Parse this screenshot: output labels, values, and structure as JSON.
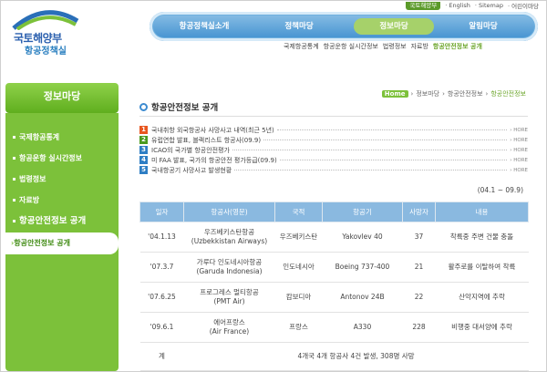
{
  "header": {
    "logo_main": "국토해양부",
    "logo_sub": "항공정책실",
    "util": [
      "국토해양부",
      "English",
      "Sitemap",
      "어린이마당"
    ]
  },
  "gnb": [
    "항공정책실소개",
    "정책마당",
    "정보마당",
    "알림마당"
  ],
  "lnb": [
    "국제항공통계",
    "항공운항 실시간정보",
    "법령정보",
    "자료방",
    "항공안전정보 공개"
  ],
  "sidebar": {
    "title": "정보마당",
    "items": [
      "국제항공통계",
      "항공운항 실시간정보",
      "법령정보",
      "자료방",
      "항공안전정보 공개"
    ],
    "sub": "항공안전정보 공개"
  },
  "breadcrumb": [
    "Home",
    "정보마당",
    "항공안전정보",
    "항공안전정보"
  ],
  "page_title": "항공안전정보 공개",
  "news": [
    {
      "num": "1",
      "text": "국내취항 외국항공사 사망사고 내역(최근 5년)",
      "more": "HORE"
    },
    {
      "num": "2",
      "text": "유럽연합 발표, 블랙리스트 항공사(09.9)",
      "more": "HORE"
    },
    {
      "num": "3",
      "text": "ICAO의 국가별 항공안전평가",
      "more": "HORE"
    },
    {
      "num": "4",
      "text": "미 FAA 발표, 국가의 항공안전 평가등급(09.9)",
      "more": "HORE"
    },
    {
      "num": "5",
      "text": "국내항공기 사망사고 발생현황",
      "more": "HORE"
    }
  ],
  "news_colors": [
    "#e8561f",
    "#4a9a1e",
    "#2e7ec4",
    "#2e7ec4",
    "#2e7ec4"
  ],
  "period": "(04.1 ~ 09.9)",
  "table": {
    "headers": [
      "일자",
      "항공사(영문)",
      "국적",
      "항공기",
      "사망자",
      "내용"
    ],
    "rows": [
      {
        "date": "'04.1.13",
        "airline": "우즈베키스탄항공",
        "airline_en": "(Uzbekkistan Airways)",
        "country": "우즈베키스탄",
        "aircraft": "Yakovlev 40",
        "deaths": "37",
        "content": "착륙중 주변 건물 충돌"
      },
      {
        "date": "'07.3.7",
        "airline": "가루다 인도네시아항공",
        "airline_en": "(Garuda Indonesia)",
        "country": "인도네시아",
        "aircraft": "Boeing 737-400",
        "deaths": "21",
        "content": "활주로를 이탈하여 착륙"
      },
      {
        "date": "'07.6.25",
        "airline": "프로그레스 멀티항공",
        "airline_en": "(PMT Air)",
        "country": "캄보디아",
        "aircraft": "Antonov 24B",
        "deaths": "22",
        "content": "산악지역에 추락"
      },
      {
        "date": "'09.6.1",
        "airline": "에어프랑스",
        "airline_en": "(Air France)",
        "country": "프랑스",
        "aircraft": "A330",
        "deaths": "228",
        "content": "비행중 대서양에 추락"
      }
    ],
    "total_label": "계",
    "total_text": "4개국 4개 항공사 4건 발생, 308명 사망"
  }
}
